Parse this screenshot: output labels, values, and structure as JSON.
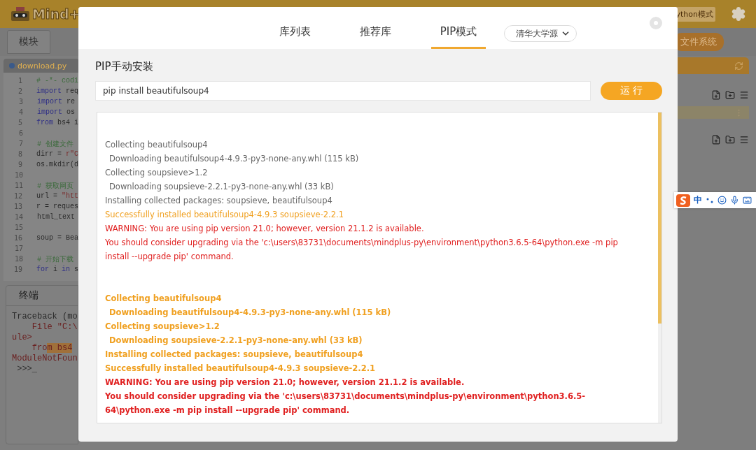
{
  "app": {
    "logo": "Mind+",
    "mode_badge": "ython模式",
    "nav_tabs": [
      {
        "label": "模块"
      }
    ],
    "file_system_button": "文件系统"
  },
  "editor": {
    "file_tab": "download.py",
    "lines": [
      {
        "number": "1",
        "tokens": [
          {
            "text": "# -*- codi",
            "kind": "comment"
          }
        ]
      },
      {
        "number": "2",
        "tokens": [
          {
            "text": "import",
            "kind": "keyword"
          },
          {
            "text": " req",
            "kind": "plain"
          }
        ]
      },
      {
        "number": "3",
        "tokens": [
          {
            "text": "import",
            "kind": "keyword"
          },
          {
            "text": " re",
            "kind": "plain"
          }
        ]
      },
      {
        "number": "4",
        "tokens": [
          {
            "text": "import",
            "kind": "keyword"
          },
          {
            "text": " os",
            "kind": "plain"
          }
        ]
      },
      {
        "number": "5",
        "tokens": [
          {
            "text": "from",
            "kind": "keyword"
          },
          {
            "text": " bs4 i",
            "kind": "plain"
          }
        ]
      },
      {
        "number": "6"
      },
      {
        "number": "7",
        "tokens": [
          {
            "text": "# 创建文件",
            "kind": "comment"
          }
        ]
      },
      {
        "number": "8",
        "tokens": [
          {
            "text": "dirr = ",
            "kind": "plain"
          },
          {
            "text": "r\"C",
            "kind": "string"
          }
        ]
      },
      {
        "number": "9",
        "tokens": [
          {
            "text": "os.mkdir(d",
            "kind": "plain"
          }
        ]
      },
      {
        "number": "10"
      },
      {
        "number": "11",
        "tokens": [
          {
            "text": "# 获取网页",
            "kind": "comment"
          }
        ]
      },
      {
        "number": "12",
        "tokens": [
          {
            "text": "url = ",
            "kind": "plain"
          },
          {
            "text": "\"htt",
            "kind": "string"
          }
        ]
      },
      {
        "number": "13",
        "tokens": [
          {
            "text": "r = reques",
            "kind": "plain"
          }
        ]
      },
      {
        "number": "14",
        "tokens": [
          {
            "text": "html_text",
            "kind": "plain"
          }
        ]
      },
      {
        "number": "15"
      },
      {
        "number": "16",
        "tokens": [
          {
            "text": "soup = Bea",
            "kind": "plain"
          }
        ]
      },
      {
        "number": "17"
      },
      {
        "number": "18",
        "tokens": [
          {
            "text": "# 开始下载",
            "kind": "comment"
          }
        ]
      },
      {
        "number": "19",
        "tokens": [
          {
            "text": "for",
            "kind": "keyword"
          },
          {
            "text": " i ",
            "kind": "plain"
          },
          {
            "text": "in",
            "kind": "keyword"
          },
          {
            "text": " s",
            "kind": "plain"
          }
        ]
      }
    ]
  },
  "terminal": {
    "title": "终端",
    "lines": [
      {
        "tokens": [
          {
            "text": "Traceback (mo",
            "kind": "plain"
          }
        ]
      },
      {
        "tokens": [
          {
            "text": "    File \"C:\\",
            "kind": "error"
          }
        ]
      },
      {
        "tokens": [
          {
            "text": "ule>",
            "kind": "error"
          }
        ]
      },
      {
        "tokens": [
          {
            "text": "    fro",
            "kind": "error"
          },
          {
            "text": "m bs4",
            "kind": "highlight"
          }
        ]
      },
      {
        "tokens": [
          {
            "text": "ModuleNotFoun",
            "kind": "error"
          }
        ]
      },
      {
        "tokens": [
          {
            "text": " >>>_",
            "kind": "prompt"
          }
        ]
      }
    ]
  },
  "dialog": {
    "tabs": [
      {
        "label": "库列表",
        "selected": false
      },
      {
        "label": "推荐库",
        "selected": false
      },
      {
        "label": "PIP模式",
        "selected": true
      }
    ],
    "source": "清华大学源",
    "section_title": "PIP手动安装",
    "command": {
      "value": "pip install beautifulsoup4"
    },
    "run_button": "运 行",
    "output": {
      "blocks": [
        {
          "bold": false,
          "lines": [
            {
              "text": "Collecting beautifulsoup4",
              "kind": "info",
              "indent": false
            },
            {
              "text": "Downloading beautifulsoup4-4.9.3-py3-none-any.whl (115 kB)",
              "kind": "info",
              "indent": true
            },
            {
              "text": "Collecting soupsieve>1.2",
              "kind": "info",
              "indent": false
            },
            {
              "text": "Downloading soupsieve-2.2.1-py3-none-any.whl (33 kB)",
              "kind": "info",
              "indent": true
            },
            {
              "text": "Installing collected packages: soupsieve, beautifulsoup4",
              "kind": "info",
              "indent": false
            },
            {
              "text": "Successfully installed beautifulsoup4-4.9.3 soupsieve-2.2.1",
              "kind": "success",
              "indent": false
            },
            {
              "text": "WARNING: You are using pip version 21.0; however, version 21.1.2 is available.",
              "kind": "warning",
              "indent": false
            },
            {
              "text": "You should consider upgrading via the 'c:\\users\\83731\\documents\\mindplus-py\\environment\\python3.6.5-64\\python.exe -m pip install --upgrade pip' command.",
              "kind": "warning",
              "indent": false
            }
          ]
        },
        {
          "bold": true,
          "lines": [
            {
              "text": "Collecting beautifulsoup4",
              "kind": "success",
              "indent": false
            },
            {
              "text": "Downloading beautifulsoup4-4.9.3-py3-none-any.whl (115 kB)",
              "kind": "success",
              "indent": true
            },
            {
              "text": "Collecting soupsieve>1.2",
              "kind": "success",
              "indent": false
            },
            {
              "text": "Downloading soupsieve-2.2.1-py3-none-any.whl (33 kB)",
              "kind": "success",
              "indent": true
            },
            {
              "text": "Installing collected packages: soupsieve, beautifulsoup4",
              "kind": "success",
              "indent": false
            },
            {
              "text": "Successfully installed beautifulsoup4-4.9.3 soupsieve-2.2.1",
              "kind": "success",
              "indent": false
            },
            {
              "text": "WARNING: You are using pip version 21.0; however, version 21.1.2 is available.",
              "kind": "warning",
              "indent": false
            },
            {
              "text": "You should consider upgrading via the 'c:\\users\\83731\\documents\\mindplus-py\\environment\\python3.6.5-64\\python.exe -m pip install --upgrade pip' command.",
              "kind": "warning",
              "indent": false
            }
          ]
        }
      ]
    }
  },
  "ime_bar": {
    "mode": "中"
  }
}
